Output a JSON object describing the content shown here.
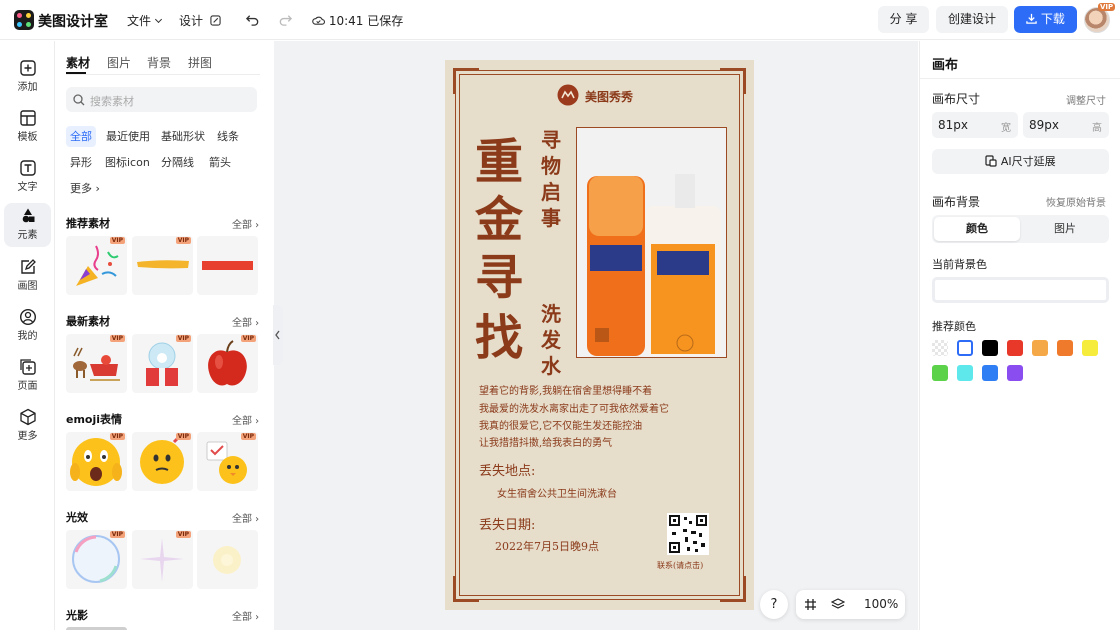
{
  "app": {
    "title": "美图设计室"
  },
  "toolbar": {
    "file_menu": "文件",
    "design_menu": "设计",
    "saved_status": "10:41 已保存",
    "share_label": "分 享",
    "create_label": "创建设计",
    "download_label": "下载",
    "vip_badge": "VIP"
  },
  "leftnav": {
    "items": [
      {
        "label": "添加",
        "icon": "plus-square-icon"
      },
      {
        "label": "模板",
        "icon": "template-icon"
      },
      {
        "label": "文字",
        "icon": "text-icon"
      },
      {
        "label": "元素",
        "icon": "shapes-icon"
      },
      {
        "label": "画图",
        "icon": "pencil-icon"
      },
      {
        "label": "我的",
        "icon": "user-icon"
      },
      {
        "label": "页面",
        "icon": "page-add-icon"
      },
      {
        "label": "更多",
        "icon": "cube-icon"
      }
    ]
  },
  "panel": {
    "tabs": [
      "素材",
      "图片",
      "背景",
      "拼图"
    ],
    "search_placeholder": "搜索素材",
    "chips": [
      "全部",
      "最近使用",
      "基础形状",
      "线条",
      "异形",
      "图标icon",
      "分隔线",
      "箭头",
      "更多"
    ],
    "all_label": "全部",
    "vip": "VIP",
    "sections": [
      {
        "title": "推荐素材"
      },
      {
        "title": "最新素材"
      },
      {
        "title": "emoji表情"
      },
      {
        "title": "光效"
      },
      {
        "title": "光影"
      }
    ]
  },
  "poster": {
    "brand": "美图秀秀",
    "headline": [
      "重",
      "金",
      "寻",
      "找"
    ],
    "subtitle": [
      "寻",
      "物",
      "启",
      "事"
    ],
    "item": [
      "洗",
      "发",
      "水"
    ],
    "story": [
      "望着它的背影,我躺在宿舍里想得睡不着",
      "我最爱的洗发水离家出走了可我依然爱着它",
      "我真的很爱它,它不仅能生发还能控油",
      "让我措措抖擞,给我表白的勇气"
    ],
    "lost_place_label": "丢失地点:",
    "lost_place": "女生宿舍公共卫生间洗漱台",
    "lost_date_label": "丢失日期:",
    "lost_date": "2022年7月5日晚9点",
    "contact": "联系(请点击)"
  },
  "canvas": {
    "zoom": "100%",
    "help": "?"
  },
  "rightpanel": {
    "title": "画布",
    "size_label": "画布尺寸",
    "adjust_size": "调整尺寸",
    "width_value": "81px",
    "width_unit": "宽",
    "height_value": "89px",
    "height_unit": "高",
    "ai_extend": "AI尺寸延展",
    "bg_label": "画布背景",
    "restore_bg": "恢复原始背景",
    "seg_color": "颜色",
    "seg_image": "图片",
    "current_bg": "当前背景色",
    "recommended": "推荐颜色",
    "swatches": [
      "transparent",
      "#ffffff",
      "#000000",
      "#e8382a",
      "#f4a848",
      "#f07a2c",
      "#f5ec3c",
      "#5cd14a",
      "#5ee8ec",
      "#2f7ef4",
      "#8a4df0"
    ]
  }
}
